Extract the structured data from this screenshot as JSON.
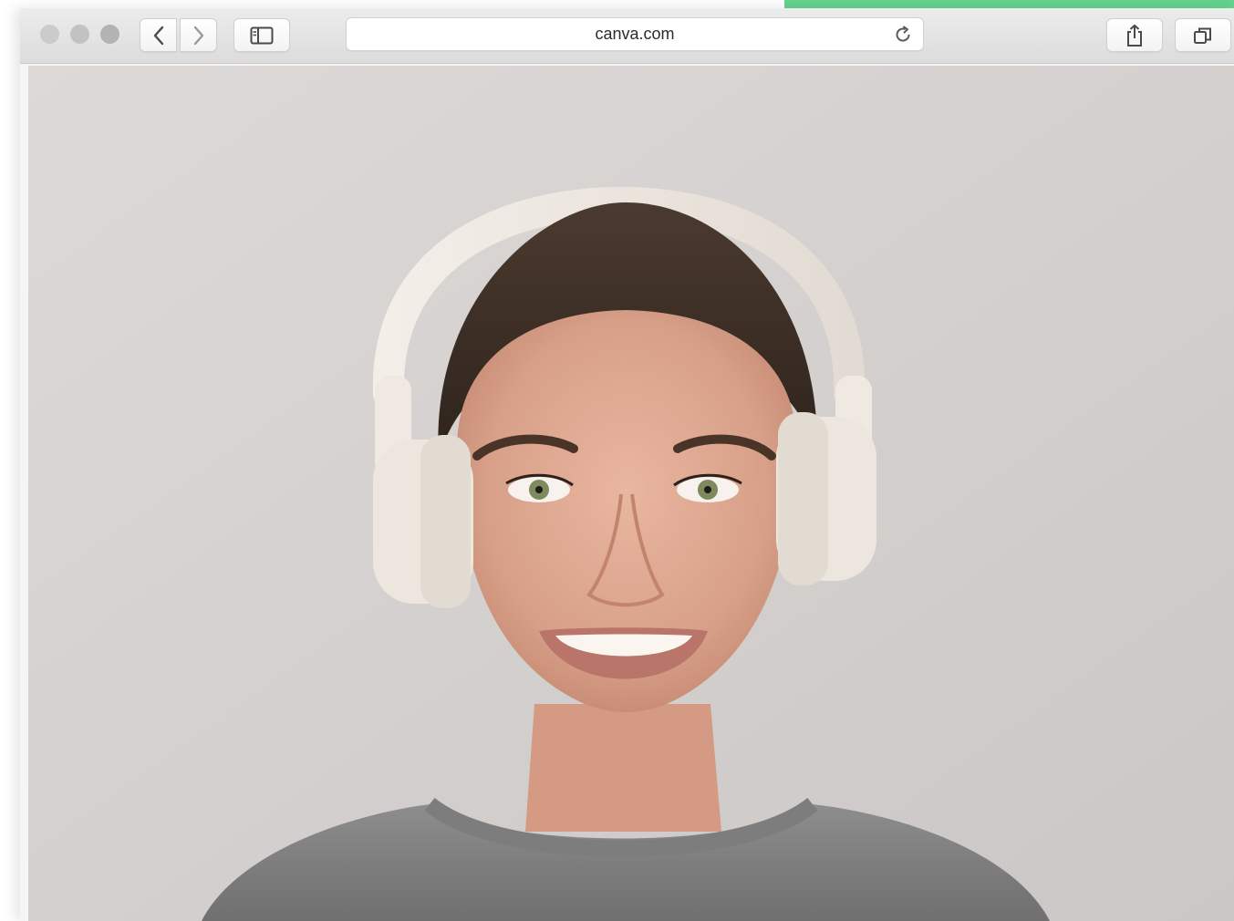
{
  "browser": {
    "url": "canva.com",
    "accent_color": "#63d38f"
  },
  "toolbar": {
    "icons": {
      "back": "chevron-left-icon",
      "forward": "chevron-right-icon",
      "sidebar": "sidebar-icon",
      "reload": "reload-icon",
      "share": "share-icon",
      "tabs": "tabs-icon"
    }
  },
  "content": {
    "image_subject": "photo"
  }
}
